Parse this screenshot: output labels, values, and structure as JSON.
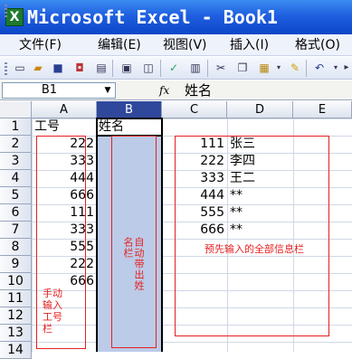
{
  "window": {
    "title": "Microsoft Excel - Book1",
    "app_icon": "excel-icon"
  },
  "menu": [
    {
      "label": "文件(F)"
    },
    {
      "label": "编辑(E)"
    },
    {
      "label": "视图(V)"
    },
    {
      "label": "插入(I)"
    },
    {
      "label": "格式(O)"
    }
  ],
  "toolbar": [
    "new-icon",
    "open-icon",
    "save-icon",
    "permission-icon",
    "print-icon",
    "print-preview-icon",
    "spelling-icon",
    "cut-icon",
    "copy-icon",
    "paste-icon",
    "format-painter-icon",
    "undo-icon"
  ],
  "formula_bar": {
    "name_box": "B1",
    "fx": "fx",
    "value": "姓名"
  },
  "columns": [
    "A",
    "B",
    "C",
    "D",
    "E"
  ],
  "rows": [
    "1",
    "2",
    "3",
    "4",
    "5",
    "6",
    "7",
    "8",
    "9",
    "10",
    "11",
    "12",
    "13",
    "14"
  ],
  "cells": {
    "A1": "工号",
    "B1": "姓名",
    "A": [
      "222",
      "333",
      "444",
      "666",
      "111",
      "333",
      "555",
      "222",
      "666"
    ],
    "C": [
      "111",
      "222",
      "333",
      "444",
      "555",
      "666"
    ],
    "D": [
      "张三",
      "李四",
      "王二",
      "**",
      "**",
      "**"
    ]
  },
  "annotations": {
    "a_note": "手动输入工号栏",
    "b_note": "自动带出姓名栏",
    "cd_note": "预先输入的全部信息栏"
  },
  "colors": {
    "accent": "#30489c",
    "annotation": "#e52020",
    "selection": "#bccbe8"
  }
}
